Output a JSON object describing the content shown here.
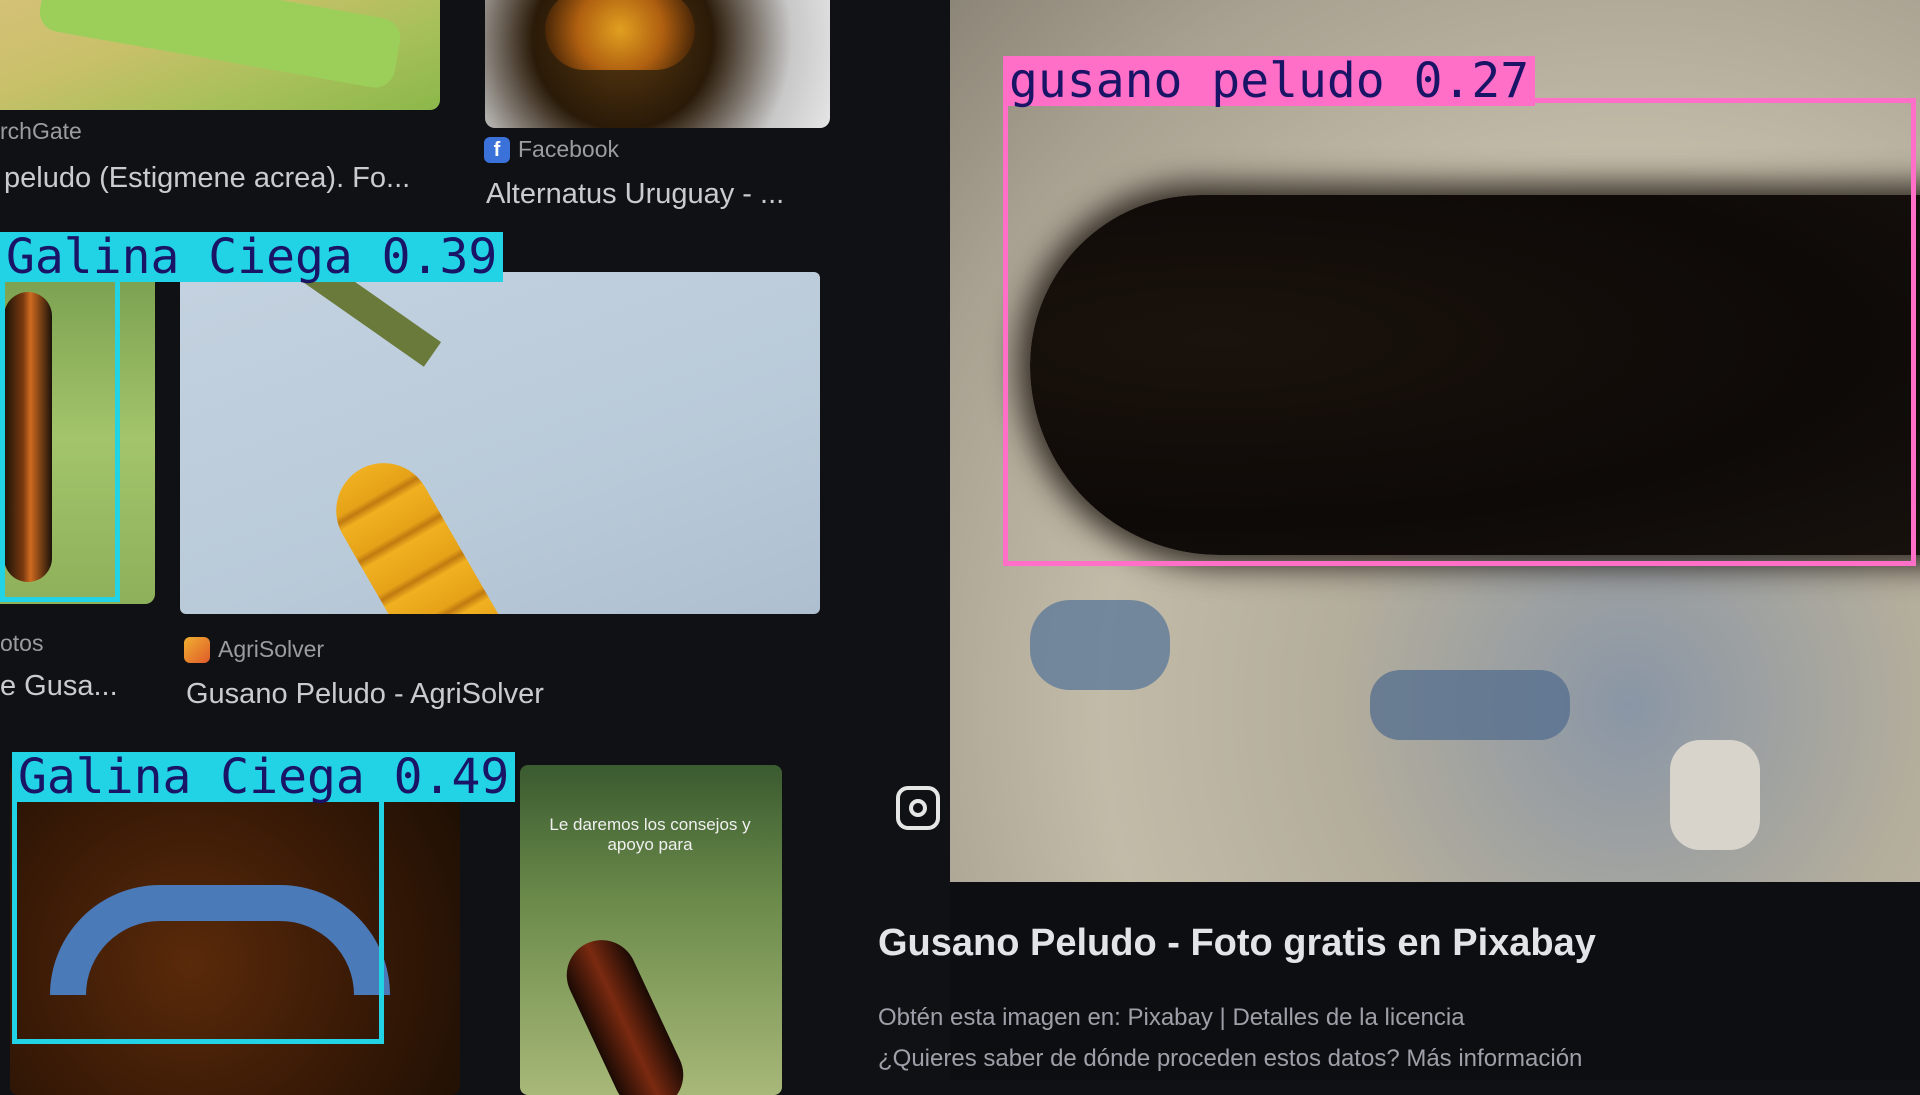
{
  "results": [
    {
      "source": "rchGate",
      "title": "peludo (Estigmene acrea). Fo..."
    },
    {
      "source": "Facebook",
      "title": "Alternatus Uruguay - ..."
    },
    {
      "source": "otos",
      "title": "e Gusa..."
    },
    {
      "source": "AgriSolver",
      "title": "Gusano Peludo - AgriSolver"
    }
  ],
  "thumb_overlay_text": "Le daremos los consejos y apoyo para",
  "preview": {
    "title": "Gusano Peludo - Foto gratis en Pixabay",
    "obtain_text": "Obtén esta imagen en: Pixabay | Detalles de la licencia",
    "origin_text": "¿Quieres saber de dónde proceden estos datos? Más información",
    "lens_icon": "lens-icon"
  },
  "detections": [
    {
      "label": "gusano peludo 0.27",
      "color": "#ff6ec7"
    },
    {
      "label": "Galina Ciega 0.39",
      "color": "#22d3e6"
    },
    {
      "label": "Galina Ciega 0.49",
      "color": "#22d3e6"
    }
  ]
}
